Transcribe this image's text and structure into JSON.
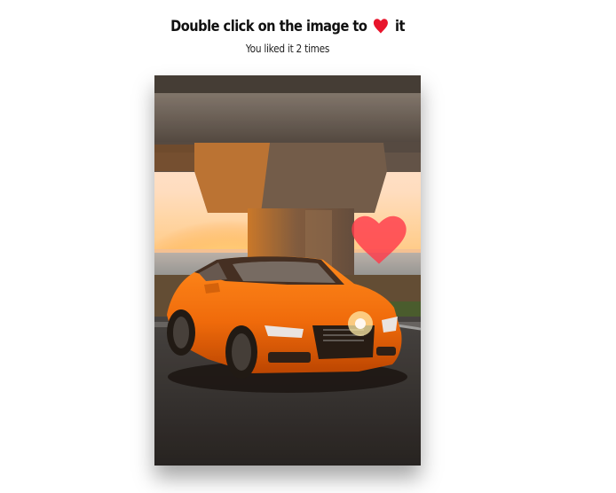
{
  "header": {
    "title_before": "Double click on the image to",
    "heart_icon": "heart-icon",
    "title_after": "it"
  },
  "counter": {
    "text": "You liked it 2 times",
    "count": 2
  },
  "photo": {
    "subject": "orange-coupe-under-bridge-at-sunset",
    "overlay_icon": "heart-icon"
  },
  "colors": {
    "heart": "#e8142b",
    "overlay_heart": "#ff3b4a",
    "text": "#111111"
  }
}
